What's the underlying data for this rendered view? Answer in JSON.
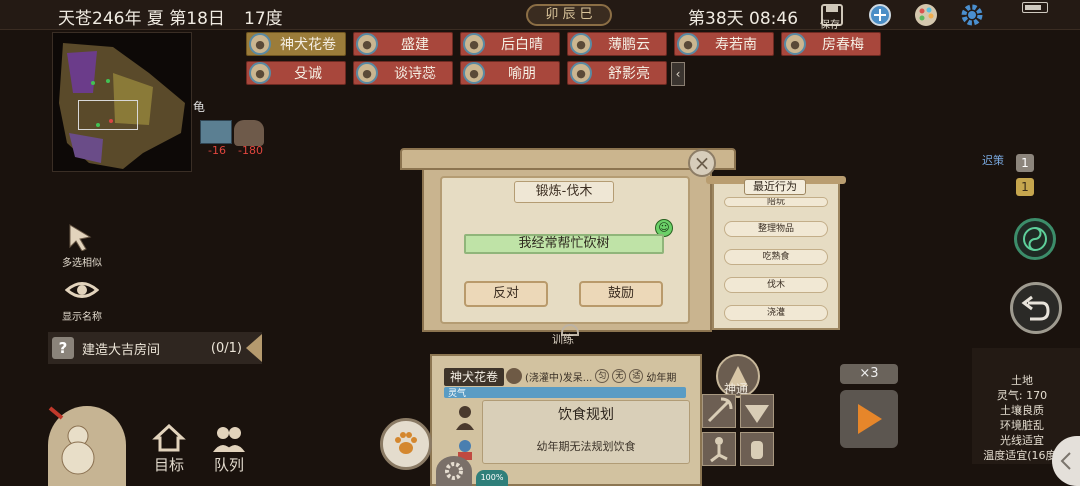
{
  "topbar": {
    "date": "天苍246年 夏 第18日",
    "temperature": "17度",
    "season_emblem": "卯 辰 巳",
    "clock": "第38天 08:46",
    "save_label": "保存"
  },
  "minimap": {
    "side_label": "龟"
  },
  "resources": [
    {
      "name": "stone-bin",
      "value": "-16"
    },
    {
      "name": "pot",
      "value": "-180"
    }
  ],
  "characters_row1": [
    "神犬花卷",
    "盛建",
    "后白晴",
    "薄鹏云",
    "寿若南",
    "房春梅"
  ],
  "characters_row2": [
    "殳诚",
    "谈诗蕊",
    "喻朋",
    "舒影亮"
  ],
  "left_buttons": {
    "multi_select": "多选相似",
    "show_names": "显示名称"
  },
  "quest": {
    "label": "建造大吉房间",
    "count": "(0/1)"
  },
  "bottom_left": {
    "target": "目标",
    "queue": "队列"
  },
  "dialog": {
    "title": "锻炼-伐木",
    "status": "我经常帮忙砍树",
    "btn_oppose": "反对",
    "btn_encourage": "鼓励"
  },
  "recent": {
    "title": "最近行为",
    "items": [
      "陪玩",
      "整理物品",
      "吃熟食",
      "伐木",
      "浇灌"
    ]
  },
  "train_label": "训练",
  "bottom_panel": {
    "name": "神犬花卷",
    "info": "(浇灌中)发呆...",
    "tags": [
      "匀",
      "无",
      "适"
    ],
    "stage": "幼年期",
    "lingqi_label": "灵气",
    "card_title": "饮食规划",
    "card_sub": "幼年期无法规划饮食",
    "percent": "100%"
  },
  "shentong": "神通",
  "right": {
    "strategy_label": "迟策",
    "badge1": "1",
    "badge2": "1",
    "speed": "×3"
  },
  "environment": {
    "title": "土地",
    "lines": [
      "灵气: 170",
      "土壤良质",
      "环境脏乱",
      "光线适宜",
      "温度适宜(16度)"
    ]
  },
  "colors": {
    "chip_red": "#a8473c",
    "chip_gold": "#9b7c3a",
    "status_green": "#bfe3a7",
    "lingqi_blue": "#5a9cc4"
  }
}
